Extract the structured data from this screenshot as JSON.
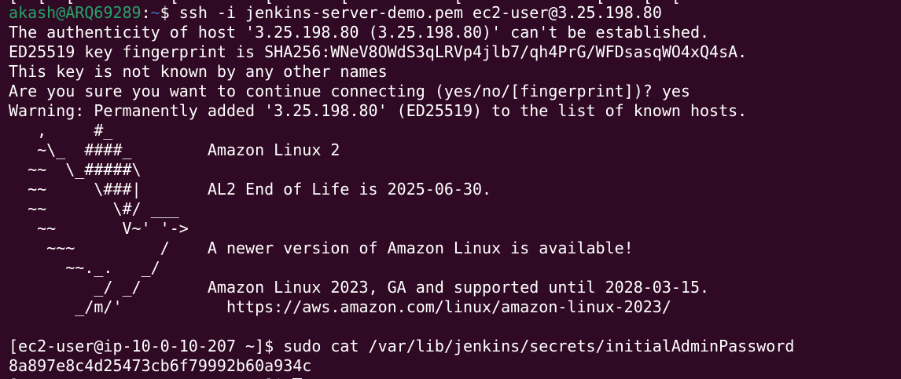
{
  "terminal": {
    "top_partial": "[  [  [          [         [       [           [              [    [  [",
    "prompt": {
      "user_host": "akash@ARQ69289",
      "separator": ":",
      "path": "~",
      "symbol": "$ ",
      "command": "ssh -i jenkins-server-demo.pem ec2-user@3.25.198.80"
    },
    "output_lines": [
      "The authenticity of host '3.25.198.80 (3.25.198.80)' can't be established.",
      "ED25519 key fingerprint is SHA256:WNeV8OWdS3qLRVp4jlb7/qh4PrG/WFDsasqWO4xQ4sA.",
      "This key is not known by any other names",
      "Are you sure you want to continue connecting (yes/no/[fingerprint])? yes",
      "Warning: Permanently added '3.25.198.80' (ED25519) to the list of known hosts."
    ],
    "banner_lines": [
      "   ,     #_",
      "   ~\\_  ####_        Amazon Linux 2",
      "  ~~  \\_#####\\",
      "  ~~     \\###|       AL2 End of Life is 2025-06-30.",
      "  ~~       \\#/ ___",
      "   ~~       V~' '->",
      "    ~~~         /    A newer version of Amazon Linux is available!",
      "      ~~._.   _/",
      "         _/ _/       Amazon Linux 2023, GA and supported until 2028-03-15.",
      "       _/m/'           https://aws.amazon.com/linux/amazon-linux-2023/"
    ],
    "remote_command_line": "[ec2-user@ip-10-0-10-207 ~]$ sudo cat /var/lib/jenkins/secrets/initialAdminPassword",
    "password_output": "8a897e8c4d25473cb6f79992b60a934c",
    "bottom_partial": "[                          ]$ "
  }
}
